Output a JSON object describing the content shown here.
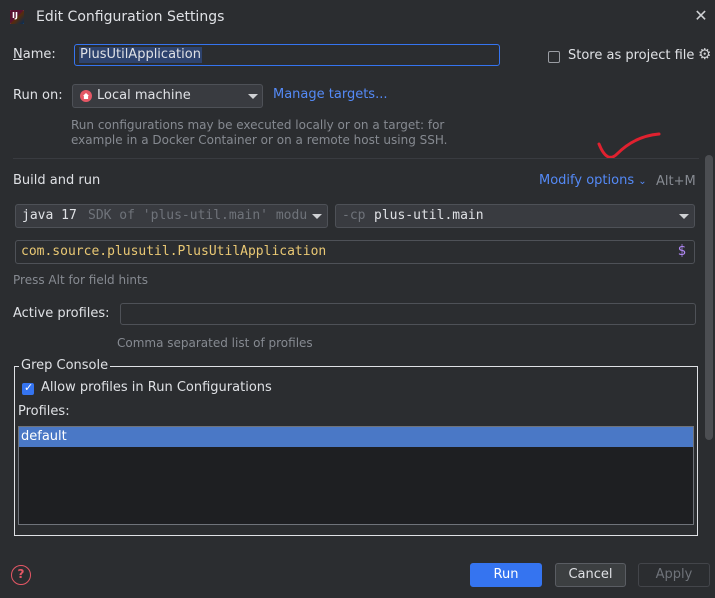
{
  "window": {
    "title": "Edit Configuration Settings",
    "app_icon_text": "IJ"
  },
  "name_row": {
    "label_prefix": "N",
    "label_rest": "ame:",
    "value": "PlusUtilApplication",
    "store_label": "Store as project file",
    "store_checked": false
  },
  "run_on": {
    "label": "Run on:",
    "selected": "Local machine",
    "manage_link": "Manage targets...",
    "hint_line1": "Run configurations may be executed locally or on a target: for",
    "hint_line2": "example in a Docker Container or on a remote host using SSH."
  },
  "build_and_run": {
    "title": "Build and run",
    "modify_label": "Modify options",
    "modify_shortcut": "Alt+M",
    "jre_version": "java 17",
    "jre_detail": "SDK of 'plus-util.main' module",
    "cp_flag": "-cp",
    "cp_value": "plus-util.main",
    "main_class": "com.source.plusutil.PlusUtilApplication",
    "main_class_suffix": "$",
    "field_hint": "Press Alt for field hints"
  },
  "profiles": {
    "label": "Active profiles:",
    "value": "",
    "hint": "Comma separated list of profiles"
  },
  "grep_console": {
    "title": "Grep Console",
    "allow_label": "Allow profiles in Run Configurations",
    "allow_checked": true,
    "profiles_label": "Profiles:",
    "items": [
      "default"
    ]
  },
  "footer": {
    "help": "?",
    "run": "Run",
    "cancel": "Cancel",
    "apply": "Apply"
  },
  "colors": {
    "background": "#2b2d30",
    "accent": "#3574f0",
    "link": "#548af7",
    "main_class_text": "#e9c874",
    "selection": "#4a78c6",
    "error": "#e55765"
  }
}
